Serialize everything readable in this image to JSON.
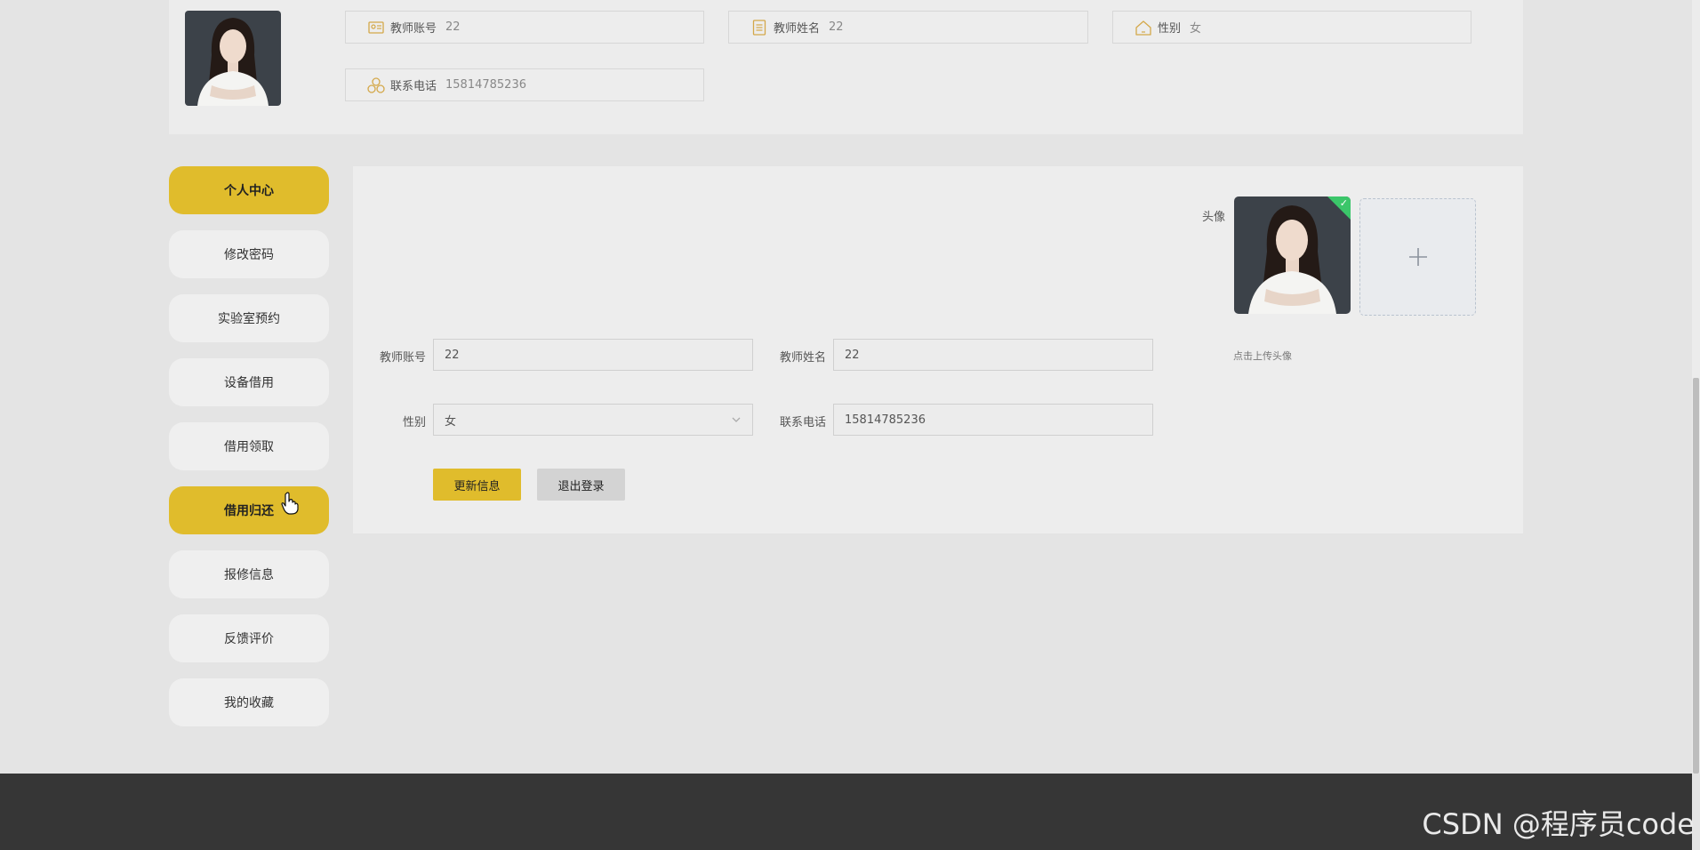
{
  "profile": {
    "account_label": "教师账号",
    "account_value": "22",
    "name_label": "教师姓名",
    "name_value": "22",
    "gender_label": "性别",
    "gender_value": "女",
    "phone_label": "联系电话",
    "phone_value": "15814785236"
  },
  "sidebar": {
    "items": [
      {
        "label": "个人中心"
      },
      {
        "label": "修改密码"
      },
      {
        "label": "实验室预约"
      },
      {
        "label": "设备借用"
      },
      {
        "label": "借用领取"
      },
      {
        "label": "借用归还"
      },
      {
        "label": "报修信息"
      },
      {
        "label": "反馈评价"
      },
      {
        "label": "我的收藏"
      }
    ]
  },
  "form": {
    "avatar_label": "头像",
    "upload_hint": "点击上传头像",
    "account_label": "教师账号",
    "account_value": "22",
    "name_label": "教师姓名",
    "name_value": "22",
    "gender_label": "性别",
    "gender_value": "女",
    "phone_label": "联系电话",
    "phone_value": "15814785236",
    "update_button": "更新信息",
    "logout_button": "退出登录"
  },
  "watermark": "CSDN @程序员code",
  "colors": {
    "accent": "#e0bc2c",
    "footer": "#363636",
    "success": "#3bc66a"
  }
}
